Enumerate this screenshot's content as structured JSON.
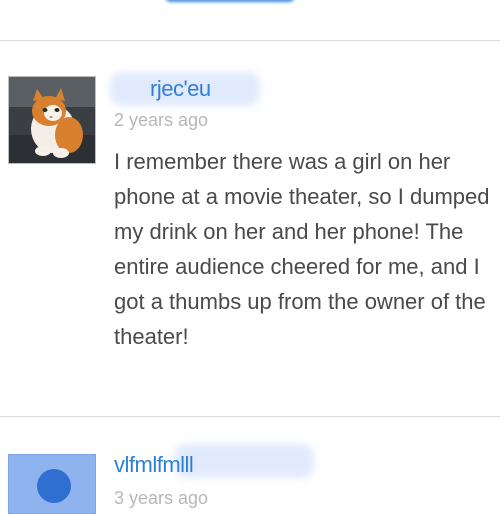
{
  "comments": [
    {
      "username": "rjec'eu",
      "timestamp": "2 years ago",
      "avatar": "orange-white-cat-photo",
      "body": "I remember there was a girl on her phone at a movie theater, so I dumped my drink on her and her phone! The entire audience cheered for me, and I got a thumbs up from the owner of the theater!"
    },
    {
      "username": "vlfmlfmlll",
      "timestamp": "3 years ago",
      "avatar": "default-blue-avatar"
    }
  ],
  "colors": {
    "link": "#2f7fd9",
    "timestamp": "#b7b7b7",
    "body_text": "#4a4a4a",
    "divider": "#d9d9d9",
    "avatar_blue": "#8fb3ee"
  }
}
